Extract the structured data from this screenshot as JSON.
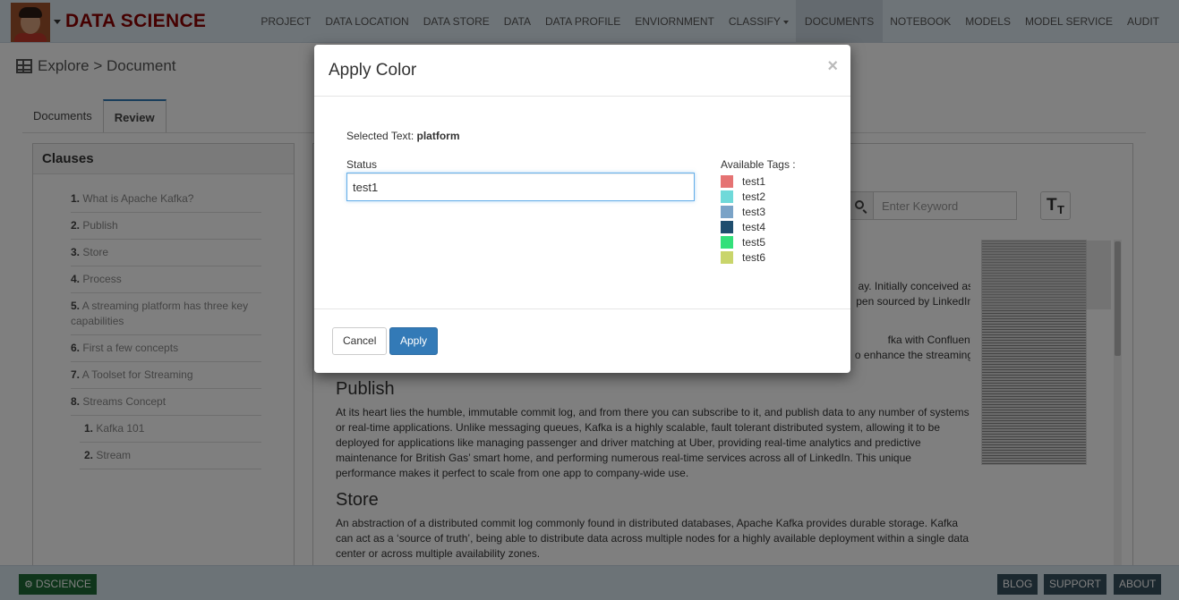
{
  "header": {
    "brand": "DATA SCIENCE",
    "nav": [
      {
        "label": "PROJECT"
      },
      {
        "label": "DATA LOCATION"
      },
      {
        "label": "DATA STORE"
      },
      {
        "label": "DATA"
      },
      {
        "label": "DATA PROFILE"
      },
      {
        "label": "ENVIORNMENT"
      },
      {
        "label": "CLASSIFY"
      },
      {
        "label": "DOCUMENTS"
      },
      {
        "label": "NOTEBOOK"
      },
      {
        "label": "MODELS"
      },
      {
        "label": "MODEL SERVICE"
      },
      {
        "label": "AUDIT"
      }
    ],
    "active_nav": "DOCUMENTS"
  },
  "breadcrumb": {
    "text": "Explore > Document"
  },
  "tabs": [
    {
      "label": "Documents"
    },
    {
      "label": "Review"
    }
  ],
  "active_tab": "Review",
  "clauses": {
    "title": "Clauses",
    "items": [
      {
        "num": "1.",
        "text": "What is Apache Kafka?"
      },
      {
        "num": "2.",
        "text": "Publish"
      },
      {
        "num": "3.",
        "text": "Store"
      },
      {
        "num": "4.",
        "text": "Process"
      },
      {
        "num": "5.",
        "text": "A streaming platform has three key capabilities"
      },
      {
        "num": "6.",
        "text": "First a few concepts"
      },
      {
        "num": "7.",
        "text": "A Toolset for Streaming"
      },
      {
        "num": "8.",
        "text": "Streams Concept"
      }
    ],
    "sub_items": [
      {
        "num": "1.",
        "text": "Kafka 101"
      },
      {
        "num": "2.",
        "text": "Stream"
      }
    ]
  },
  "document": {
    "search_placeholder": "Enter Keyword",
    "text_size_button": "TT",
    "sections": [
      {
        "heading": "Publish",
        "body": "At its heart lies the humble, immutable commit log, and from there you can subscribe to it, and publish data to any number of systems or real-time applications. Unlike messaging queues, Kafka is a highly scalable, fault tolerant distributed system, allowing it to be deployed for applications like managing passenger and driver matching at Uber, providing real-time analytics and predictive maintenance for British Gas’ smart home, and performing numerous real-time services across all of LinkedIn. This unique performance makes it perfect to scale from one app to company-wide use."
      },
      {
        "heading": "Store",
        "body": "An abstraction of a distributed commit log commonly found in distributed databases, Apache Kafka provides durable storage. Kafka can act as a ‘source of truth’, being able to distribute data across multiple nodes for a highly available deployment within a single data center or across multiple availability zones."
      }
    ],
    "partial_lines": [
      "ay. Initially conceived as",
      "pen sourced by LinkedIn",
      "fka with Confluent",
      "o enhance the streaming"
    ]
  },
  "modal": {
    "title": "Apply Color",
    "close": "×",
    "selected_label": "Selected Text:",
    "selected_value": "platform",
    "status_label": "Status",
    "status_value": "test1",
    "tags_label": "Available Tags :",
    "tags": [
      {
        "name": "test1",
        "color": "#e57373"
      },
      {
        "name": "test2",
        "color": "#6fd9d9"
      },
      {
        "name": "test3",
        "color": "#7aa3c7"
      },
      {
        "name": "test4",
        "color": "#1f4e6e"
      },
      {
        "name": "test5",
        "color": "#33e07a"
      },
      {
        "name": "test6",
        "color": "#c9d56b"
      }
    ],
    "cancel_label": "Cancel",
    "apply_label": "Apply"
  },
  "footer": {
    "brand": "DSCIENCE",
    "links": [
      {
        "label": "BLOG"
      },
      {
        "label": "SUPPORT"
      },
      {
        "label": "ABOUT"
      }
    ]
  }
}
